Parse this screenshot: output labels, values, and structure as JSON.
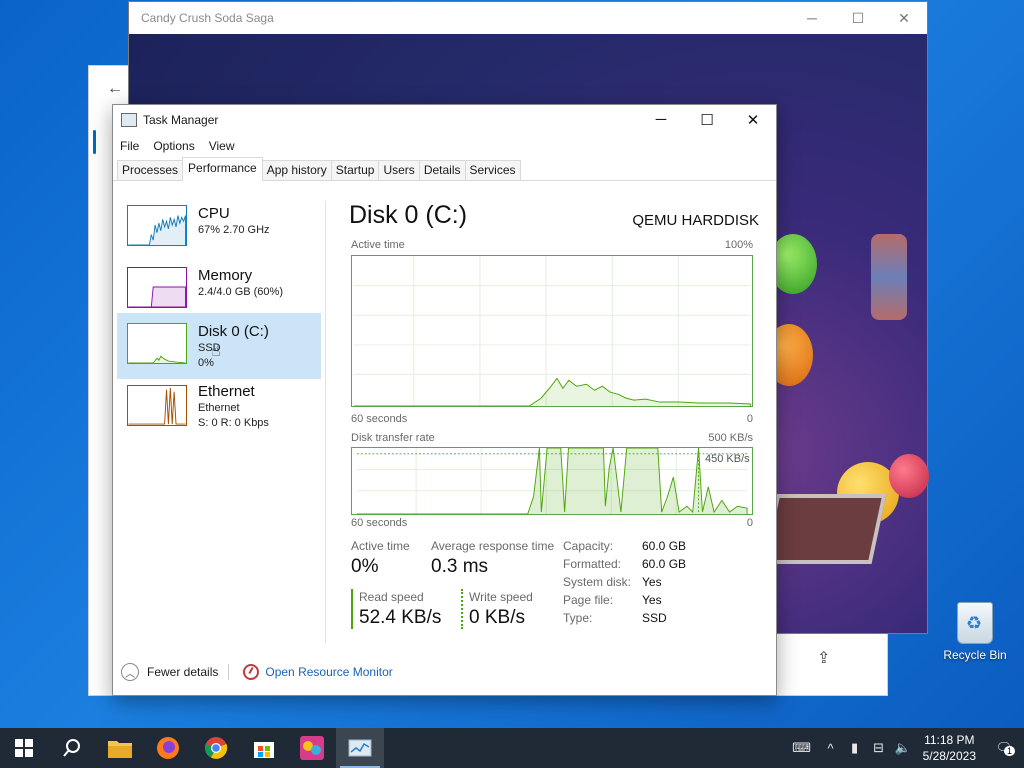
{
  "candy_window": {
    "title": "Candy Crush Soda Saga"
  },
  "task_manager": {
    "title": "Task Manager",
    "menu": [
      "File",
      "Options",
      "View"
    ],
    "tabs": [
      "Processes",
      "Performance",
      "App history",
      "Startup",
      "Users",
      "Details",
      "Services"
    ],
    "active_tab": "Performance",
    "sidebar": [
      {
        "name": "CPU",
        "line1": "67% 2.70 GHz",
        "line2": "",
        "color": "#117dbb"
      },
      {
        "name": "Memory",
        "line1": "2.4/4.0 GB (60%)",
        "line2": "",
        "color": "#8b12ae"
      },
      {
        "name": "Disk 0 (C:)",
        "line1": "SSD",
        "line2": "0%",
        "color": "#4da60c"
      },
      {
        "name": "Ethernet",
        "line1": "Ethernet",
        "line2": "S: 0 R: 0 Kbps",
        "color": "#a74f01"
      }
    ],
    "detail": {
      "heading": "Disk 0 (C:)",
      "model": "QEMU HARDDISK",
      "graph1": {
        "label": "Active time",
        "max": "100%",
        "time": "60 seconds",
        "min": "0"
      },
      "graph2": {
        "label": "Disk transfer rate",
        "max": "500 KB/s",
        "marker": "450 KB/s",
        "time": "60 seconds",
        "min": "0"
      },
      "stats": {
        "active_time_label": "Active time",
        "active_time": "0%",
        "avg_resp_label": "Average response time",
        "avg_resp": "0.3 ms",
        "read_label": "Read speed",
        "read": "52.4 KB/s",
        "write_label": "Write speed",
        "write": "0 KB/s"
      },
      "props": [
        {
          "k": "Capacity:",
          "v": "60.0 GB"
        },
        {
          "k": "Formatted:",
          "v": "60.0 GB"
        },
        {
          "k": "System disk:",
          "v": "Yes"
        },
        {
          "k": "Page file:",
          "v": "Yes"
        },
        {
          "k": "Type:",
          "v": "SSD"
        }
      ]
    },
    "footer": {
      "fewer_details": "Fewer details",
      "resource_monitor": "Open Resource Monitor"
    }
  },
  "desktop": {
    "recycle_bin": "Recycle Bin"
  },
  "taskbar": {
    "time": "11:18 PM",
    "date": "5/28/2023",
    "notifications": "1"
  }
}
